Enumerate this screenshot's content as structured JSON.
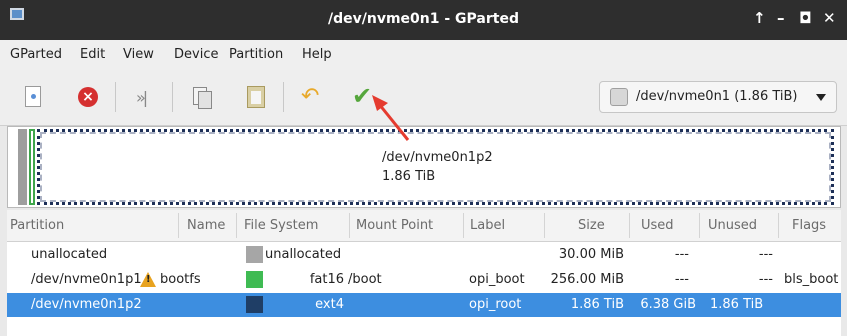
{
  "window": {
    "title": "/dev/nvme0n1 - GParted",
    "buttons": [
      "↑",
      "–",
      "◘",
      "✕"
    ]
  },
  "menu": [
    "GParted",
    "Edit",
    "View",
    "Device",
    "Partition",
    "Help"
  ],
  "toolbar": {
    "icons": [
      "new-partition-icon",
      "delete-icon",
      "resize-move-icon",
      "copy-icon",
      "paste-icon",
      "undo-icon",
      "apply-icon"
    ],
    "device_selector": "/dev/nvme0n1 (1.86 TiB)"
  },
  "disk_graphic": {
    "selected_name": "/dev/nvme0n1p2",
    "selected_size": "1.86 TiB"
  },
  "table": {
    "columns": [
      "Partition",
      "Name",
      "File System",
      "Mount Point",
      "Label",
      "Size",
      "Used",
      "Unused",
      "Flags"
    ],
    "rows": [
      {
        "partition": "unallocated",
        "name": "",
        "fs": "unallocated",
        "fs_color": "#a6a6a6",
        "mount": "",
        "label": "",
        "size": "30.00 MiB",
        "used": "---",
        "unused": "---",
        "flags": ""
      },
      {
        "partition": "/dev/nvme0n1p1",
        "name": "bootfs",
        "fs": "fat16",
        "fs_color": "#3fbb53",
        "mount": "/boot",
        "label": "opi_boot",
        "size": "256.00 MiB",
        "used": "---",
        "unused": "---",
        "flags": "bls_boot",
        "warning": true
      },
      {
        "partition": "/dev/nvme0n1p2",
        "name": "",
        "fs": "ext4",
        "fs_color": "#1f3e66",
        "mount": "",
        "label": "opi_root",
        "size": "1.86 TiB",
        "used": "6.38 GiB",
        "unused": "1.86 TiB",
        "flags": "",
        "selected": true
      }
    ]
  },
  "colors": {
    "selection": "#3d8ee0",
    "titlebar": "#2e2e2e",
    "annotation_arrow": "#e53b2f"
  }
}
